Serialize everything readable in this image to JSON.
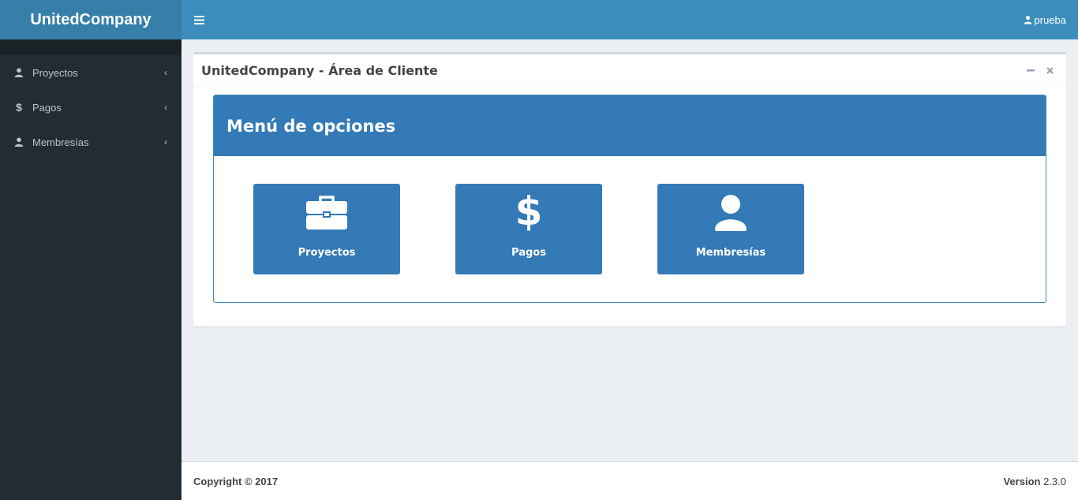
{
  "app": {
    "brand": "UnitedCompany"
  },
  "header": {
    "user_name": "prueba"
  },
  "sidebar": {
    "items": [
      {
        "label": "Proyectos",
        "icon": "user-icon"
      },
      {
        "label": "Pagos",
        "icon": "dollar-icon"
      },
      {
        "label": "Membresías",
        "icon": "user-icon"
      }
    ]
  },
  "box": {
    "title": "UnitedCompany - Área de Cliente"
  },
  "panel": {
    "title": "Menú de opciones",
    "tiles": [
      {
        "label": "Proyectos",
        "icon": "briefcase-icon"
      },
      {
        "label": "Pagos",
        "icon": "dollar-icon"
      },
      {
        "label": "Membresías",
        "icon": "user-icon"
      }
    ]
  },
  "footer": {
    "copyright": "Copyright © 2017",
    "version_label": "Version",
    "version_value": "2.3.0"
  },
  "colors": {
    "header": "#3c8dbc",
    "logo": "#367fa9",
    "sidebar": "#222d32",
    "panel": "#337ab7",
    "background": "#ecf0f5"
  }
}
